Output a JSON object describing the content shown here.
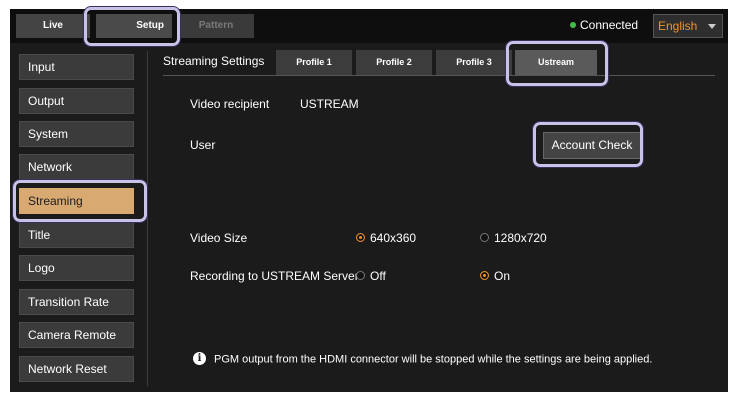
{
  "topbar": {
    "tabs": [
      {
        "label": "Live",
        "state": "normal"
      },
      {
        "label": "Setup",
        "state": "selected"
      },
      {
        "label": "Pattern",
        "state": "disabled"
      }
    ],
    "status": {
      "text": "Connected",
      "color": "#3fbf4a"
    },
    "language": {
      "value": "English"
    }
  },
  "sidebar": {
    "items": [
      {
        "label": "Input"
      },
      {
        "label": "Output"
      },
      {
        "label": "System"
      },
      {
        "label": "Network"
      },
      {
        "label": "Streaming",
        "active": true
      },
      {
        "label": "Title"
      },
      {
        "label": "Logo"
      },
      {
        "label": "Transition Rate"
      },
      {
        "label": "Camera Remote"
      },
      {
        "label": "Network Reset"
      }
    ]
  },
  "streaming": {
    "title": "Streaming Settings",
    "tabs": [
      {
        "label": "Profile 1"
      },
      {
        "label": "Profile 2"
      },
      {
        "label": "Profile 3"
      },
      {
        "label": "Ustream",
        "active": true
      }
    ],
    "video_recipient": {
      "label": "Video recipient",
      "value": "USTREAM"
    },
    "user": {
      "label": "User",
      "button": "Account Check"
    },
    "video_size": {
      "label": "Video Size",
      "options": [
        "640x360",
        "1280x720"
      ],
      "selected": "640x360"
    },
    "recording": {
      "label": "Recording to USTREAM Server",
      "options": [
        "Off",
        "On"
      ],
      "selected": "On"
    },
    "info": {
      "icon": "info-icon",
      "text": "PGM output from the HDMI connector will be stopped while the settings are being applied."
    }
  },
  "colors": {
    "accent": "#f0902a",
    "active_sidebar": "#d9a972",
    "background": "#1b1b1b",
    "highlight": "#c8c2e6"
  }
}
